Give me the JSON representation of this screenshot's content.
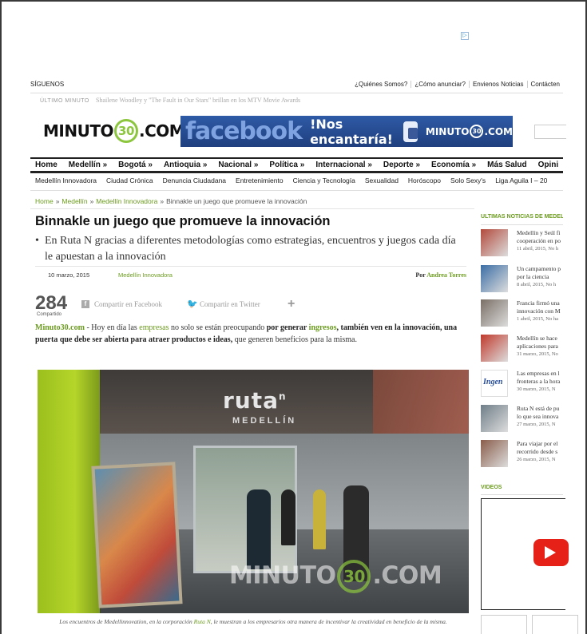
{
  "ad_marker": "▷",
  "top": {
    "follow": "SÍGUENOS",
    "links": [
      "¿Quiénes Somos?",
      "¿Cómo anunciar?",
      "Envienos Noticias",
      "Contácten"
    ]
  },
  "ticker": {
    "tag": "ÚLTIMO MINUTO",
    "text": "Shailene Woodley y \"The Fault in Our Stars\" brillan en los MTV Movie Awards"
  },
  "logo": {
    "pre": "MINUTO",
    "num": "30",
    "post": ".COM"
  },
  "banner": {
    "fb": "facebook",
    "msg": "!Nos encantaría!",
    "pre": "MINUTO",
    "num": "30",
    "post": ".COM"
  },
  "nav": [
    "Home",
    "Medellín »",
    "Bogotá »",
    "Antioquia »",
    "Nacional »",
    "Política »",
    "Internacional »",
    "Deporte »",
    "Economía »",
    "Más Salud",
    "Opini"
  ],
  "subnav": [
    "Medellín Innovadora",
    "Ciudad Crónica",
    "Denuncia Ciudadana",
    "Entretenimiento",
    "Ciencia y Tecnología",
    "Sexualidad",
    "Horóscopo",
    "Solo Sexy's",
    "Liga Aguila I – 20"
  ],
  "breadcrumb": {
    "home": "Home",
    "sep": "»",
    "c1": "Medellín",
    "c2": "Medellín Innovadora",
    "current": "Binnakle un juego que promueve la innovación"
  },
  "article": {
    "title": "Binnakle un juego que promueve la innovación",
    "bullet": "•",
    "subtitle": "En Ruta N gracias a diferentes metodologías como estrategias, encuentros y juegos cada día le apuestan a la innovación",
    "date": "10 marzo, 2015",
    "category": "Medellín Innovadora",
    "by_prefix": "Por",
    "author": "Andrea Torres",
    "share_count": "284",
    "share_label": "Compartido",
    "fb_icon": "f",
    "fb_share": "Compartir en Facebook",
    "tw_icon": "🐦",
    "tw_share": "Compartir en Twitter",
    "more": "+",
    "lead": {
      "site": "Minuto30.com",
      "p1": " - Hoy en día las ",
      "w1": "empresas",
      "p2": " no solo se están preocupando ",
      "b1": "por generar ",
      "w2": "ingresos",
      "b2": ", también ven en la innovación,  una puerta que debe ser abierta para atraer productos e ideas,",
      "p3": " que generen beneficios para la misma."
    },
    "photo": {
      "sign": "ruta",
      "sign_sup": "n",
      "sign2": "MEDELLÍN",
      "wm_pre": "MINUTO",
      "wm_num": "30",
      "wm_post": ".COM"
    },
    "caption": {
      "p1": "Los encuentros de Medellinnovation, en la corporación ",
      "link": "Ruta N",
      "p2": ", le muestran a los empresarios otra manera de incentivar la creatividad en beneficio de la misma."
    }
  },
  "sidebar": {
    "head": "ÚLTIMAS NOTICIAS DE MEDELL",
    "items": [
      {
        "l1": "Medellín y Seúl fi",
        "l2": "cooperación en po",
        "date": "11 abril, 2015, No h",
        "color": "#b24a3c"
      },
      {
        "l1": "Un campamento p",
        "l2": "por la ciencia",
        "date": "8 abril, 2015, No h",
        "color": "#3b6ea5"
      },
      {
        "l1": "Francia firmó una",
        "l2": "innovación con M",
        "date": "1 abril, 2015, No ha",
        "color": "#7a6f66"
      },
      {
        "l1": "Medellín se hace",
        "l2": "aplicaciones para",
        "date": "31 marzo, 2015, No",
        "color": "#c0392b"
      },
      {
        "l1": "Las empresas en l",
        "l2": "fronteras a la hora",
        "date": "30 marzo, 2015, N",
        "color": "#2a4f9a"
      },
      {
        "l1": "Ruta N está de pu",
        "l2": "lo que sea innova",
        "date": "27 marzo, 2015, N",
        "color": "#6f7e88"
      },
      {
        "l1": "Para viajar por el",
        "l2": "recorrido desde s",
        "date": "26 marzo, 2015, N",
        "color": "#8a5d4a"
      }
    ],
    "ingen": "Ingen",
    "videos": "VIDEOS"
  },
  "colors": {
    "accent": "#6b9b1e",
    "logo_green": "#8cc63f",
    "fb_blue": "#2e5aa6",
    "youtube": "#e62117"
  }
}
